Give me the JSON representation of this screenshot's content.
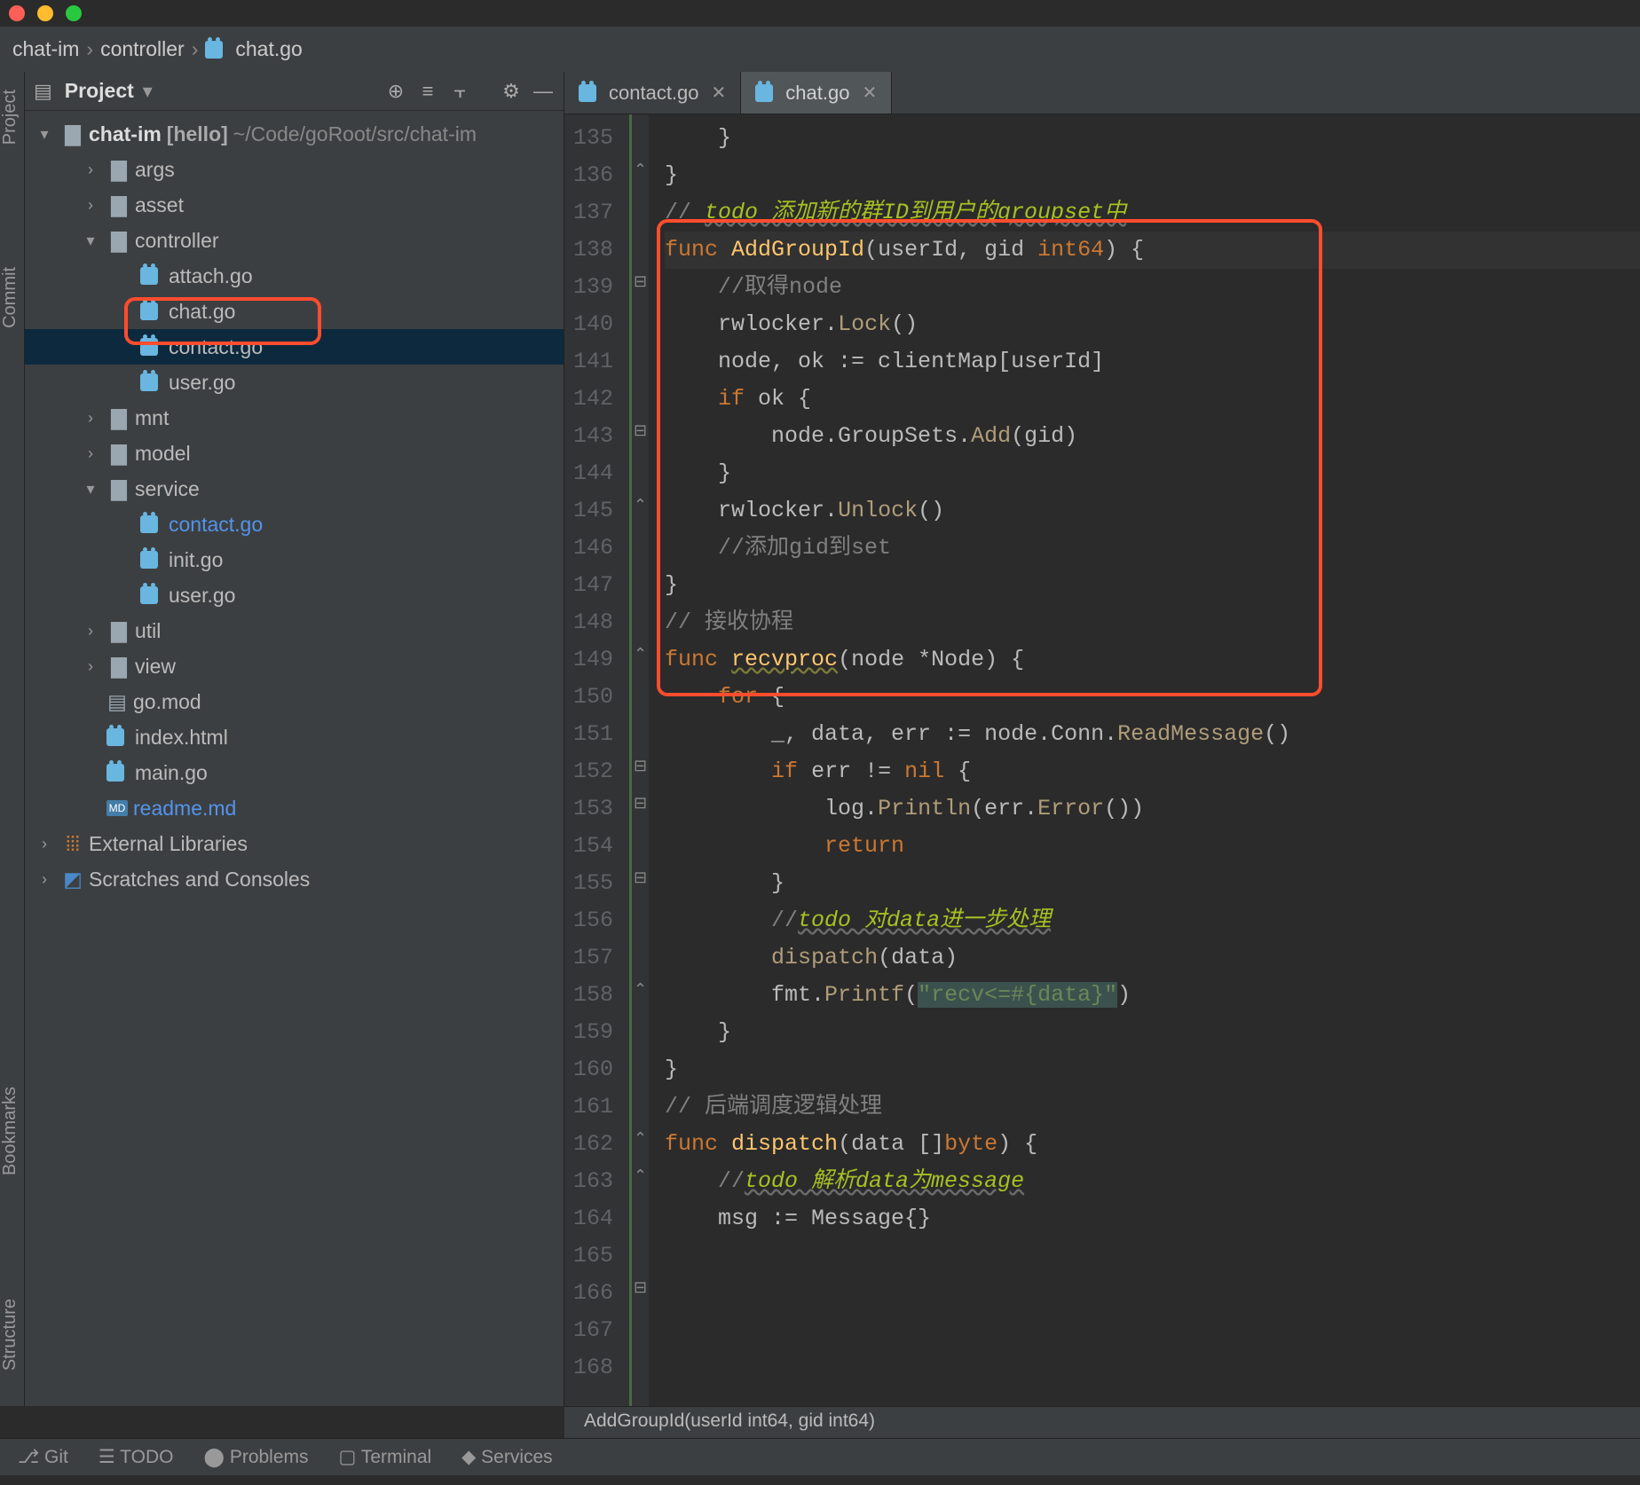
{
  "breadcrumb": {
    "p0": "chat-im",
    "p1": "controller",
    "p2": "chat.go"
  },
  "projectpanel": {
    "title": "Project"
  },
  "tree": {
    "root": {
      "name": "chat-im",
      "branch": "[hello]",
      "path": "~/Code/goRoot/src/chat-im"
    },
    "args": "args",
    "asset": "asset",
    "controller": "controller",
    "attach": "attach.go",
    "chat": "chat.go",
    "contact": "contact.go",
    "user": "user.go",
    "mnt": "mnt",
    "model": "model",
    "service": "service",
    "svc_contact": "contact.go",
    "svc_init": "init.go",
    "svc_user": "user.go",
    "util": "util",
    "view": "view",
    "gomod": "go.mod",
    "index": "index.html",
    "main": "main.go",
    "readme": "readme.md",
    "extlib": "External Libraries",
    "scratch": "Scratches and Consoles"
  },
  "tabs": {
    "t0": "contact.go",
    "t1": "chat.go"
  },
  "code": {
    "l135": "    }",
    "l136": "}",
    "l137": "",
    "l138_a": "// ",
    "l138_b": "todo 添加新的群ID到用户的groupset中",
    "l139_a": "func ",
    "l139_b": "AddGroupId",
    "l139_c": "(userId, gid ",
    "l139_d": "int64",
    "l139_e": ") {",
    "l140": "    //取得node",
    "l141_a": "    rwlocker.",
    "l141_b": "Lock",
    "l141_c": "()",
    "l142": "    node, ok := clientMap[userId]",
    "l143_a": "    ",
    "l143_b": "if ",
    "l143_c": "ok {",
    "l144_a": "        node.GroupSets.",
    "l144_b": "Add",
    "l144_c": "(gid)",
    "l145": "    }",
    "l146_a": "    rwlocker.",
    "l146_b": "Unlock",
    "l146_c": "()",
    "l147": "",
    "l148": "    //添加gid到set",
    "l149": "}",
    "l150": "",
    "l151": "// 接收协程",
    "l152_a": "func ",
    "l152_b": "recvproc",
    "l152_c": "(node *Node) {",
    "l153_a": "    ",
    "l153_b": "for ",
    "l153_c": "{",
    "l154_a": "        _, data, err := node.Conn.",
    "l154_b": "ReadMessage",
    "l154_c": "()",
    "l155_a": "        ",
    "l155_b": "if ",
    "l155_c": "err != ",
    "l155_d": "nil ",
    "l155_e": "{",
    "l156_a": "            log.",
    "l156_b": "Println",
    "l156_c": "(err.",
    "l156_d": "Error",
    "l156_e": "())",
    "l157_a": "            ",
    "l157_b": "return",
    "l158": "        }",
    "l159_a": "        //",
    "l159_b": "todo 对data进一步处理",
    "l160_a": "        ",
    "l160_b": "dispatch",
    "l160_c": "(data)",
    "l161_a": "        fmt.",
    "l161_b": "Printf",
    "l161_c": "(",
    "l161_d": "\"recv<=#{data}\"",
    "l161_e": ")",
    "l162": "    }",
    "l163": "}",
    "l164": "",
    "l165": "// 后端调度逻辑处理",
    "l166_a": "func ",
    "l166_b": "dispatch",
    "l166_c": "(data []",
    "l166_d": "byte",
    "l166_e": ") {",
    "l167_a": "    //",
    "l167_b": "todo 解析data为message",
    "l168": "    msg := Message{}"
  },
  "status": "AddGroupId(userId int64, gid int64)",
  "bottombar": {
    "git": "Git",
    "todo": "TODO",
    "problems": "Problems",
    "terminal": "Terminal",
    "services": "Services"
  }
}
